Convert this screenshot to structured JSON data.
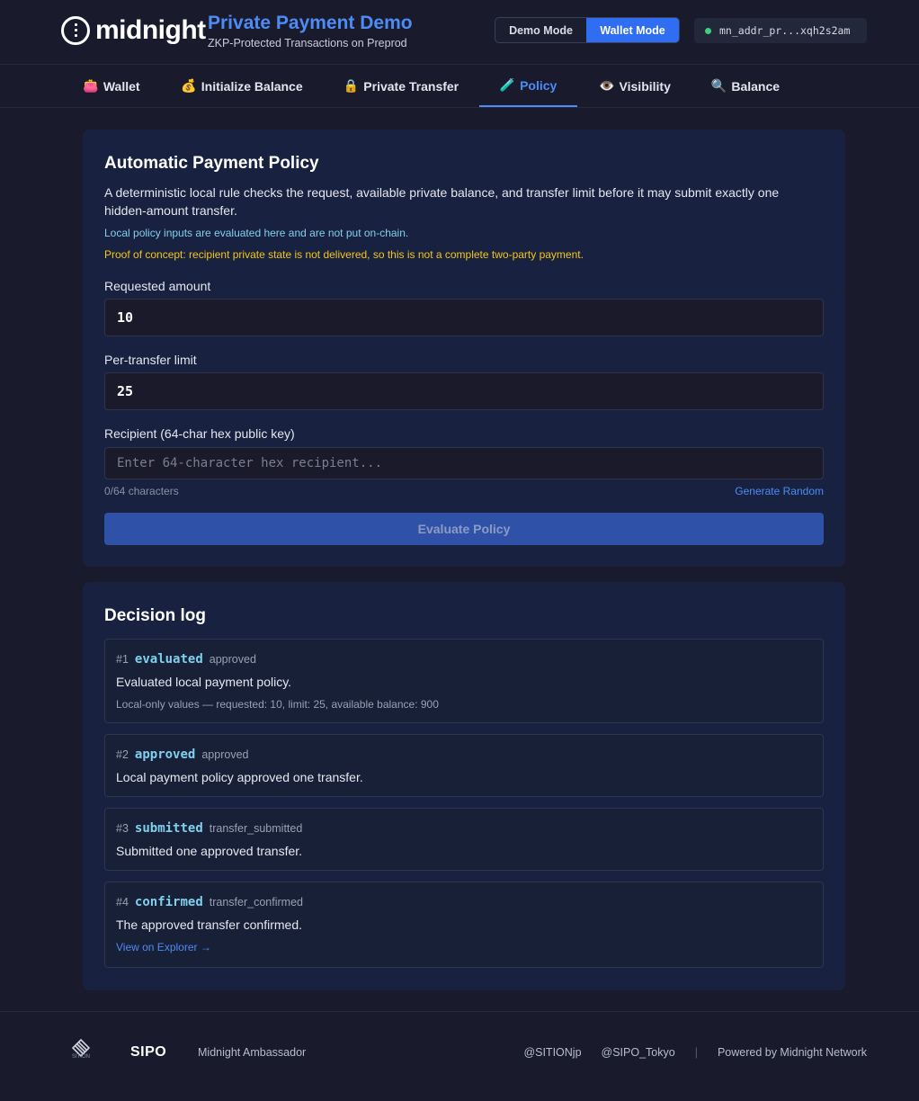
{
  "header": {
    "logo_text": "midnight",
    "app_title": "Private Payment Demo",
    "app_subtitle": "ZKP-Protected Transactions on Preprod",
    "mode_demo": "Demo Mode",
    "mode_wallet": "Wallet Mode",
    "active_mode": "Wallet Mode",
    "address": "mn_addr_pr...xqh2s2am",
    "status_color": "#3fd07c"
  },
  "tabs": [
    {
      "label": "Wallet",
      "icon": "👛",
      "icon_name": "wallet-icon"
    },
    {
      "label": "Initialize Balance",
      "icon": "💰",
      "icon_name": "money-bag-icon"
    },
    {
      "label": "Private Transfer",
      "icon": "🔒",
      "icon_name": "lock-icon"
    },
    {
      "label": "Policy",
      "icon": "🧪",
      "icon_name": "test-tube-icon",
      "active": true
    },
    {
      "label": "Visibility",
      "icon": "👁️",
      "icon_name": "eye-icon"
    },
    {
      "label": "Balance",
      "icon": "🔍",
      "icon_name": "magnifier-icon"
    }
  ],
  "policy": {
    "title": "Automatic Payment Policy",
    "description": "A deterministic local rule checks the request, available private balance, and transfer limit before it may submit exactly one hidden-amount transfer.",
    "note_local": "Local policy inputs are evaluated here and are not put on-chain.",
    "note_poc": "Proof of concept: recipient private state is not delivered, so this is not a complete two-party payment.",
    "requested_label": "Requested amount",
    "requested_value": "10",
    "limit_label": "Per-transfer limit",
    "limit_value": "25",
    "recipient_label": "Recipient (64-char hex public key)",
    "recipient_placeholder": "Enter 64-character hex recipient...",
    "char_count": "0/64 characters",
    "generate_label": "Generate Random",
    "evaluate_label": "Evaluate Policy"
  },
  "log": {
    "title": "Decision log",
    "entries": [
      {
        "num": "#1",
        "status": "evaluated",
        "kind": "approved",
        "message": "Evaluated local payment policy.",
        "detail": "Local-only values — requested: 10, limit: 25, available balance: 900"
      },
      {
        "num": "#2",
        "status": "approved",
        "kind": "approved",
        "message": "Local payment policy approved one transfer."
      },
      {
        "num": "#3",
        "status": "submitted",
        "kind": "transfer_submitted",
        "message": "Submitted one approved transfer."
      },
      {
        "num": "#4",
        "status": "confirmed",
        "kind": "transfer_confirmed",
        "message": "The approved transfer confirmed.",
        "link": "View on Explorer →"
      }
    ]
  },
  "footer": {
    "sition_caption": "SITION",
    "sipo": "SIPO",
    "ambassador": "Midnight Ambassador",
    "links": [
      "@SITIONjp",
      "@SIPO_Tokyo"
    ],
    "separator": "|",
    "powered": "Powered by Midnight Network"
  },
  "colors": {
    "accent": "#4d8bf5",
    "background": "#191b2c",
    "card": "#182240",
    "info": "#7fd0ee",
    "warning": "#f5c518"
  }
}
